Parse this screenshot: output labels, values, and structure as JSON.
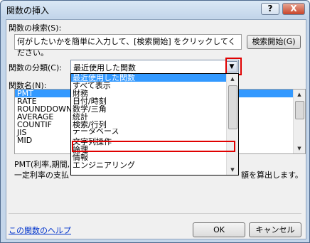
{
  "window": {
    "title": "関数の挿入",
    "help_button": "?",
    "close_button": "X"
  },
  "search": {
    "label": "関数の検索(S):",
    "value": "何がしたいかを簡単に入力して、[検索開始] をクリックしてください。",
    "button": "検索開始(G)"
  },
  "category": {
    "label": "関数の分類(C):",
    "value": "最近使用した関数",
    "options": [
      "最近使用した関数",
      "すべて表示",
      "財務",
      "日付/時刻",
      "数学/三角",
      "統計",
      "検索/行列",
      "データベース",
      "文字列操作",
      "論理",
      "情報",
      "エンジニアリング"
    ],
    "selected_index": 0,
    "highlighted_option": "文字列操作"
  },
  "function_list": {
    "label": "関数名(N):",
    "items": [
      "PMT",
      "RATE",
      "ROUNDDOWN",
      "AVERAGE",
      "COUNTIF",
      "JIS",
      "MID"
    ],
    "selected_index": 0
  },
  "description": {
    "syntax": "PMT(利率,期間,",
    "text": "一定利率の支払",
    "text_end": "額を算出します。"
  },
  "footer": {
    "help_link": "この関数のヘルプ",
    "ok": "OK",
    "cancel": "キャンセル"
  },
  "colors": {
    "selection": "#3399ff",
    "highlight_frame": "#e00000",
    "link": "#0033cc"
  }
}
